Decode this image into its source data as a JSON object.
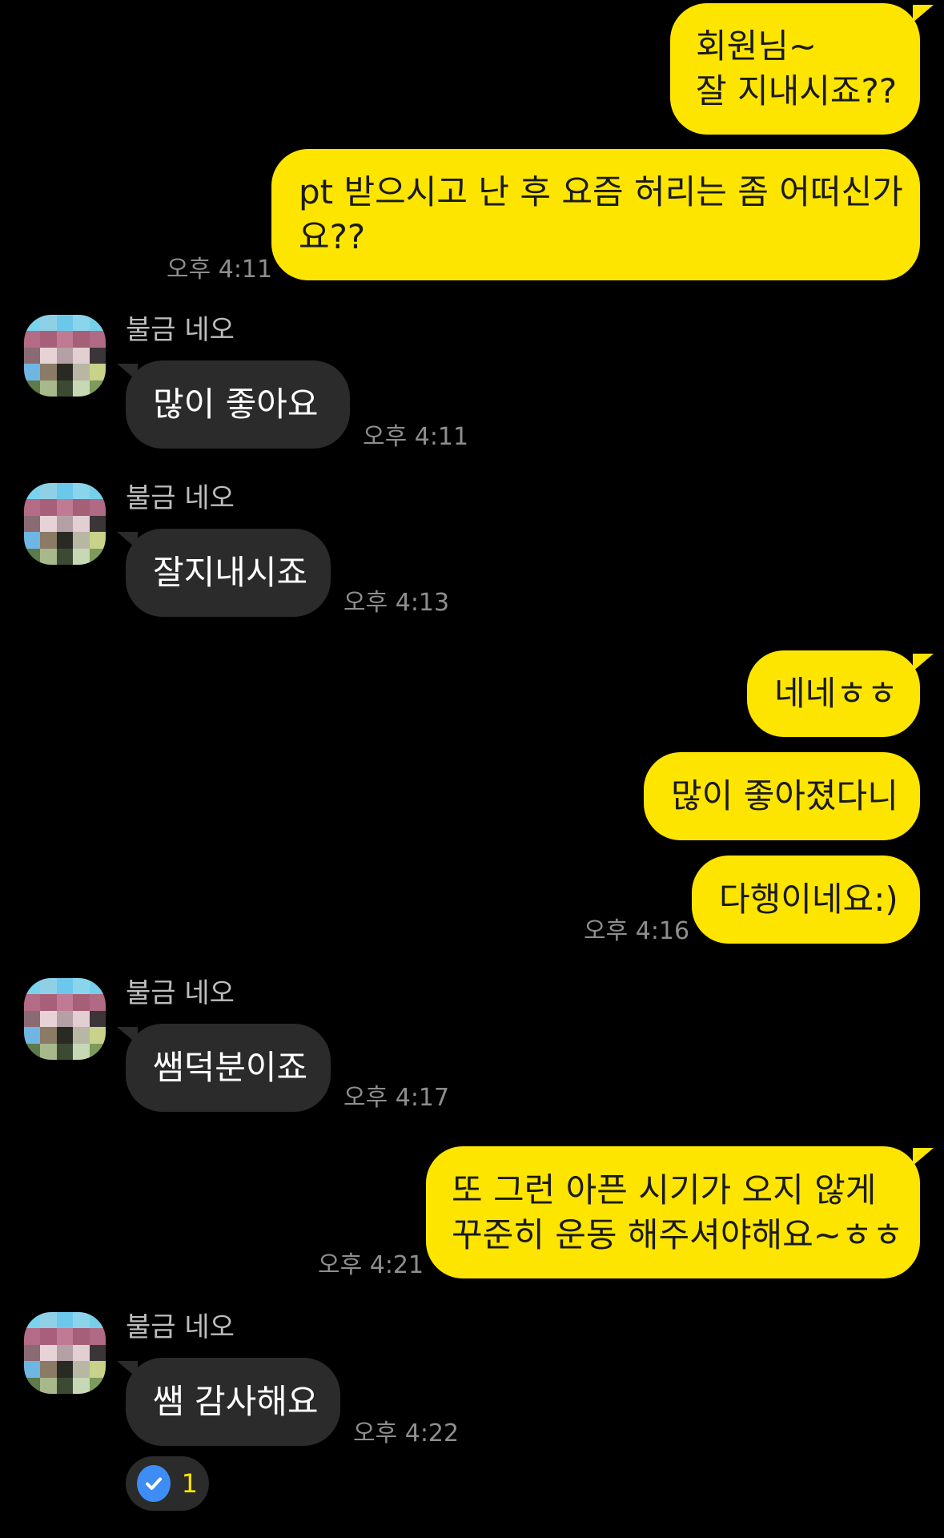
{
  "contact": {
    "name": "불금 네오"
  },
  "colors": {
    "my_bubble": "#FEE500",
    "their_bubble": "#2b2b2b",
    "background": "#000000",
    "timestamp": "#8e8e8e"
  },
  "messages": [
    {
      "sender": "me",
      "lines": [
        "회원님~",
        "잘 지내시죠??"
      ]
    },
    {
      "sender": "me",
      "lines": [
        "pt 받으시고 난 후 요즘 허리는 좀 어떠신가",
        "요??"
      ],
      "time": "오후 4:11"
    },
    {
      "sender": "them",
      "name": "불금 네오",
      "text": "많이 좋아요",
      "time": "오후 4:11"
    },
    {
      "sender": "them",
      "name": "불금 네오",
      "text": "잘지내시죠",
      "time": "오후 4:13"
    },
    {
      "sender": "me",
      "text": "네네ㅎㅎ"
    },
    {
      "sender": "me",
      "text": "많이 좋아졌다니"
    },
    {
      "sender": "me",
      "text": "다행이네요:)",
      "time": "오후 4:16"
    },
    {
      "sender": "them",
      "name": "불금 네오",
      "text": "쌤덕분이죠",
      "time": "오후 4:17"
    },
    {
      "sender": "me",
      "lines": [
        "또 그런 아픈 시기가 오지 않게",
        "꾸준히 운동 해주셔야해요~ㅎㅎ"
      ],
      "time": "오후 4:21"
    },
    {
      "sender": "them",
      "name": "불금 네오",
      "text": "쌤 감사해요",
      "time": "오후 4:22"
    }
  ],
  "read_receipt": {
    "icon": "check-circle-icon",
    "count": "1"
  }
}
